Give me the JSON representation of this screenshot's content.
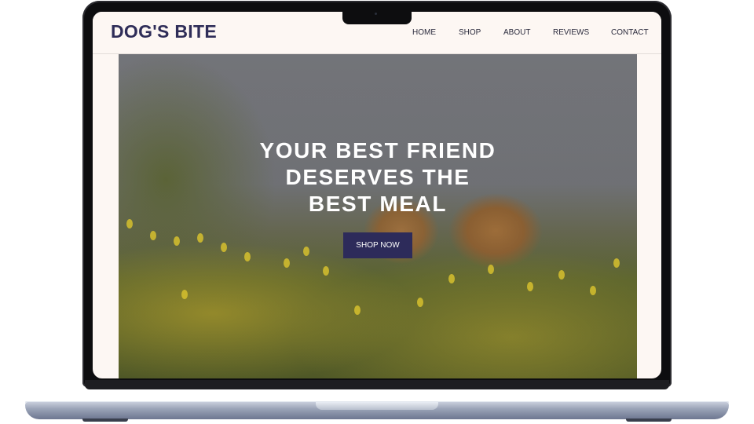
{
  "brand": {
    "name": "DOG'S BITE",
    "accent": "#2d2b5a"
  },
  "nav": {
    "items": [
      {
        "label": "HOME"
      },
      {
        "label": "SHOP"
      },
      {
        "label": "ABOUT"
      },
      {
        "label": "REVIEWS"
      },
      {
        "label": "CONTACT"
      }
    ]
  },
  "hero": {
    "title": "YOUR BEST FRIEND\nDESERVES THE\nBEST MEAL",
    "cta_label": "SHOP NOW",
    "image": "corgi-dogs-in-flower-field"
  }
}
